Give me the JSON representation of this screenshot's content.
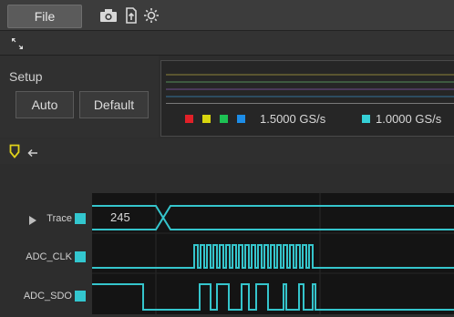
{
  "menu": {
    "file_label": "File"
  },
  "toolbar": {
    "icons": [
      "camera-icon",
      "document-upload-icon",
      "brightness-icon"
    ]
  },
  "setup": {
    "title": "Setup",
    "auto_label": "Auto",
    "default_label": "Default"
  },
  "rates": {
    "primary": "1.5000 GS/s",
    "secondary": "1.0000 GS/s",
    "primary_colors": [
      "#e22028",
      "#d9d60e",
      "#1dc254",
      "#1d8de8"
    ],
    "secondary_color": "#35d0d6"
  },
  "channels": [
    {
      "label": "Trace",
      "expandable": true
    },
    {
      "label": "ADC_CLK"
    },
    {
      "label": "ADC_SDO"
    }
  ],
  "trace": {
    "value": "245"
  },
  "colors": {
    "signal": "#35c5cc",
    "accent": "#2fc4cc",
    "marker": "#e0d21a"
  }
}
